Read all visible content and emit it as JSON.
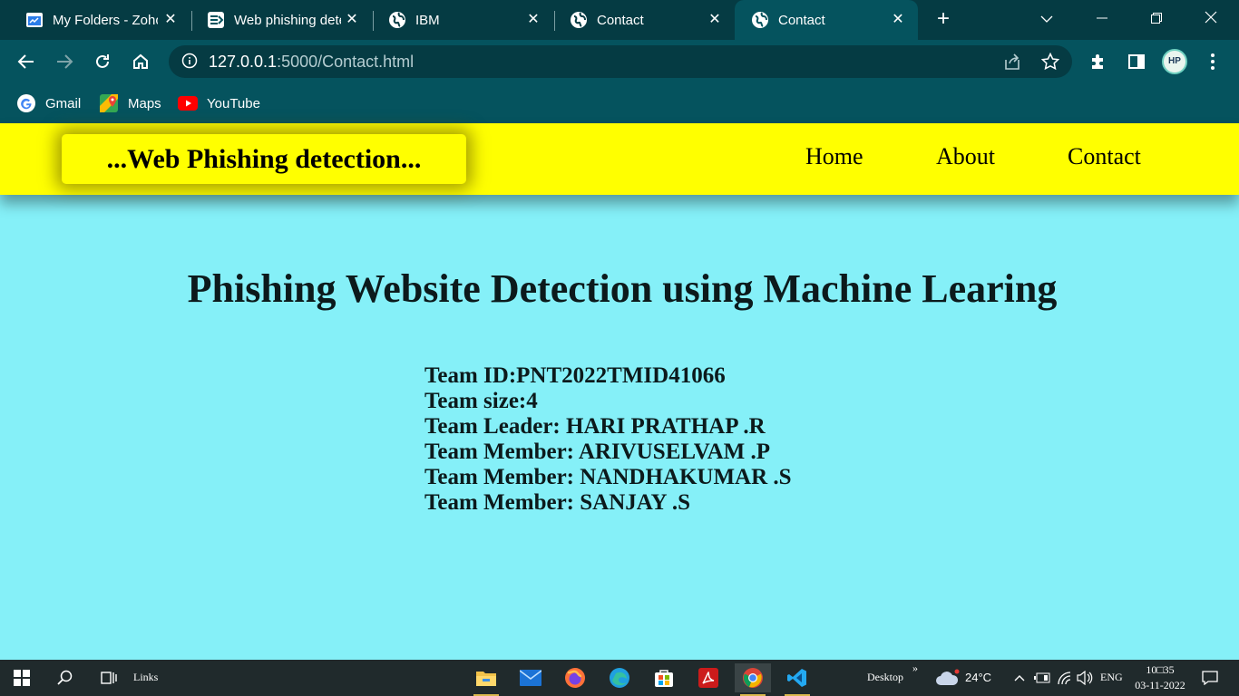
{
  "browser": {
    "tabs": [
      {
        "title": "My Folders - Zoho",
        "active": false
      },
      {
        "title": "Web phishing dete",
        "active": false
      },
      {
        "title": "IBM",
        "active": false
      },
      {
        "title": "Contact",
        "active": false
      },
      {
        "title": "Contact",
        "active": true
      }
    ],
    "url_host": "127.0.0.1",
    "url_path": ":5000/Contact.html",
    "profile_initials": "HP",
    "bookmarks": [
      {
        "label": "Gmail",
        "icon": "google-icon"
      },
      {
        "label": "Maps",
        "icon": "maps-icon"
      },
      {
        "label": "YouTube",
        "icon": "youtube-icon"
      }
    ]
  },
  "site": {
    "brand": "...Web Phishing detection...",
    "nav": [
      "Home",
      "About",
      "Contact"
    ],
    "heading": "Phishing Website Detection using Machine Learing",
    "team": {
      "id": "Team ID:PNT2022TMID41066",
      "size": "Team size:4",
      "leader": "Team Leader: HARI PRATHAP .R",
      "member1": "Team Member: ARIVUSELVAM .P",
      "member2": "Team Member: NANDHAKUMAR .S",
      "member3": "Team Member: SANJAY .S"
    }
  },
  "taskbar": {
    "links_label": "Links",
    "desktop_label": "Desktop",
    "chevron": "»",
    "weather": "24°C",
    "language": "ENG",
    "time": "10□35",
    "date": "03-11-2022"
  },
  "colors": {
    "page_bg": "#85f0f8",
    "header_bg": "#ffff00",
    "chrome_dark": "#053b43",
    "chrome_toolbar": "#05535e",
    "taskbar_bg": "#202a2c"
  }
}
